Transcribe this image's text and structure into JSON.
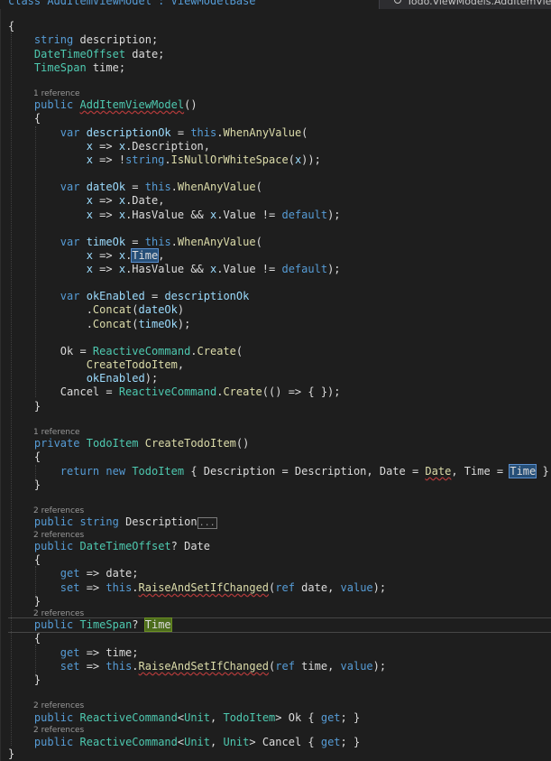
{
  "header": {
    "class_decl": "class AddItemViewModel : ViewModelBase",
    "nav_dropdown": "Todo.ViewModels.AddItemViewModel"
  },
  "codelens": {
    "ctor": "1 reference",
    "create_todo": "1 reference",
    "description_prop": "2 references",
    "date_prop": "2 references",
    "time_prop": "2 references",
    "ok_prop": "2 references",
    "cancel_prop": "2 references"
  },
  "colors": {
    "background": "#1e1e1e",
    "keyword": "#569cd6",
    "type": "#4ec9b0",
    "method": "#dcdcaa",
    "variable": "#9cdcfe",
    "text": "#dcdcdc"
  },
  "lines": [
    [
      [
        "t-plain",
        "{"
      ]
    ],
    [
      [
        "t-plain",
        "    "
      ],
      [
        "t-keyword",
        "string"
      ],
      [
        "t-plain",
        " description;"
      ]
    ],
    [
      [
        "t-plain",
        "    "
      ],
      [
        "t-type",
        "DateTimeOffset"
      ],
      [
        "t-plain",
        " date;"
      ]
    ],
    [
      [
        "t-plain",
        "    "
      ],
      [
        "t-type",
        "TimeSpan"
      ],
      [
        "t-plain",
        " time;"
      ]
    ],
    [
      [
        "t-plain",
        "    "
      ],
      [
        "t-keyword",
        "public"
      ],
      [
        "t-plain",
        " "
      ],
      [
        "t-squiggle-type",
        "AddItemViewModel"
      ],
      [
        "t-plain",
        "()"
      ]
    ],
    [
      [
        "t-plain",
        "    {"
      ]
    ],
    [
      [
        "t-plain",
        "        "
      ],
      [
        "t-keyword",
        "var"
      ],
      [
        "t-plain",
        " "
      ],
      [
        "t-var",
        "descriptionOk"
      ],
      [
        "t-plain",
        " = "
      ],
      [
        "t-keyword",
        "this"
      ],
      [
        "t-plain",
        "."
      ],
      [
        "t-method",
        "WhenAnyValue"
      ],
      [
        "t-plain",
        "("
      ]
    ],
    [
      [
        "t-plain",
        "            "
      ],
      [
        "t-var",
        "x"
      ],
      [
        "t-plain",
        " => "
      ],
      [
        "t-var",
        "x"
      ],
      [
        "t-plain",
        ".Description,"
      ]
    ],
    [
      [
        "t-plain",
        "            "
      ],
      [
        "t-var",
        "x"
      ],
      [
        "t-plain",
        " => !"
      ],
      [
        "t-keyword",
        "string"
      ],
      [
        "t-plain",
        "."
      ],
      [
        "t-method",
        "IsNullOrWhiteSpace"
      ],
      [
        "t-plain",
        "("
      ],
      [
        "t-var",
        "x"
      ],
      [
        "t-plain",
        "));"
      ]
    ],
    [
      [
        "t-plain",
        "        "
      ],
      [
        "t-keyword",
        "var"
      ],
      [
        "t-plain",
        " "
      ],
      [
        "t-var",
        "dateOk"
      ],
      [
        "t-plain",
        " = "
      ],
      [
        "t-keyword",
        "this"
      ],
      [
        "t-plain",
        "."
      ],
      [
        "t-method",
        "WhenAnyValue"
      ],
      [
        "t-plain",
        "("
      ]
    ],
    [
      [
        "t-plain",
        "            "
      ],
      [
        "t-var",
        "x"
      ],
      [
        "t-plain",
        " => "
      ],
      [
        "t-var",
        "x"
      ],
      [
        "t-plain",
        ".Date,"
      ]
    ],
    [
      [
        "t-plain",
        "            "
      ],
      [
        "t-var",
        "x"
      ],
      [
        "t-plain",
        " => "
      ],
      [
        "t-var",
        "x"
      ],
      [
        "t-plain",
        ".HasValue && "
      ],
      [
        "t-var",
        "x"
      ],
      [
        "t-plain",
        ".Value != "
      ],
      [
        "t-keyword",
        "default"
      ],
      [
        "t-plain",
        ");"
      ]
    ],
    [
      [
        "t-plain",
        "        "
      ],
      [
        "t-keyword",
        "var"
      ],
      [
        "t-plain",
        " "
      ],
      [
        "t-var",
        "timeOk"
      ],
      [
        "t-plain",
        " = "
      ],
      [
        "t-keyword",
        "this"
      ],
      [
        "t-plain",
        "."
      ],
      [
        "t-method",
        "WhenAnyValue"
      ],
      [
        "t-plain",
        "("
      ]
    ],
    [
      [
        "t-plain",
        "            "
      ],
      [
        "t-var",
        "x"
      ],
      [
        "t-plain",
        " => "
      ],
      [
        "t-var",
        "x"
      ],
      [
        "t-plain",
        "."
      ],
      [
        "t-hl",
        "Time"
      ],
      [
        "t-plain",
        ","
      ]
    ],
    [
      [
        "t-plain",
        "            "
      ],
      [
        "t-var",
        "x"
      ],
      [
        "t-plain",
        " => "
      ],
      [
        "t-var",
        "x"
      ],
      [
        "t-plain",
        ".HasValue && "
      ],
      [
        "t-var",
        "x"
      ],
      [
        "t-plain",
        ".Value != "
      ],
      [
        "t-keyword",
        "default"
      ],
      [
        "t-plain",
        ");"
      ]
    ],
    [
      [
        "t-plain",
        "        "
      ],
      [
        "t-keyword",
        "var"
      ],
      [
        "t-plain",
        " "
      ],
      [
        "t-var",
        "okEnabled"
      ],
      [
        "t-plain",
        " = "
      ],
      [
        "t-var",
        "descriptionOk"
      ]
    ],
    [
      [
        "t-plain",
        "            ."
      ],
      [
        "t-method",
        "Concat"
      ],
      [
        "t-plain",
        "("
      ],
      [
        "t-var",
        "dateOk"
      ],
      [
        "t-plain",
        ")"
      ]
    ],
    [
      [
        "t-plain",
        "            ."
      ],
      [
        "t-method",
        "Concat"
      ],
      [
        "t-plain",
        "("
      ],
      [
        "t-var",
        "timeOk"
      ],
      [
        "t-plain",
        ");"
      ]
    ],
    [
      [
        "t-plain",
        "        Ok = "
      ],
      [
        "t-type",
        "ReactiveCommand"
      ],
      [
        "t-plain",
        "."
      ],
      [
        "t-method",
        "Create"
      ],
      [
        "t-plain",
        "("
      ]
    ],
    [
      [
        "t-plain",
        "            "
      ],
      [
        "t-method",
        "CreateTodoItem"
      ],
      [
        "t-plain",
        ","
      ]
    ],
    [
      [
        "t-plain",
        "            "
      ],
      [
        "t-var",
        "okEnabled"
      ],
      [
        "t-plain",
        ");"
      ]
    ],
    [
      [
        "t-plain",
        "        Cancel = "
      ],
      [
        "t-type",
        "ReactiveCommand"
      ],
      [
        "t-plain",
        "."
      ],
      [
        "t-method",
        "Create"
      ],
      [
        "t-plain",
        "(() => { });"
      ]
    ],
    [
      [
        "t-plain",
        "    }"
      ]
    ],
    [
      [
        "t-plain",
        "    "
      ],
      [
        "t-keyword",
        "private"
      ],
      [
        "t-plain",
        " "
      ],
      [
        "t-type",
        "TodoItem"
      ],
      [
        "t-plain",
        " "
      ],
      [
        "t-method",
        "CreateTodoItem"
      ],
      [
        "t-plain",
        "()"
      ]
    ],
    [
      [
        "t-plain",
        "    {"
      ]
    ],
    [
      [
        "t-plain",
        "        "
      ],
      [
        "t-keyword",
        "return"
      ],
      [
        "t-plain",
        " "
      ],
      [
        "t-keyword",
        "new"
      ],
      [
        "t-plain",
        " "
      ],
      [
        "t-type",
        "TodoItem"
      ],
      [
        "t-plain",
        " { Description = Description, Date = "
      ],
      [
        "t-squiggle",
        "Date"
      ],
      [
        "t-plain",
        ", Time = "
      ],
      [
        "t-hl",
        "Time"
      ],
      [
        "t-plain",
        " };"
      ]
    ],
    [
      [
        "t-plain",
        "    }"
      ]
    ],
    [
      [
        "t-plain",
        "    "
      ],
      [
        "t-keyword",
        "public"
      ],
      [
        "t-plain",
        " "
      ],
      [
        "t-keyword",
        "string"
      ],
      [
        "t-plain",
        " Description"
      ],
      [
        "t-collapse",
        "..."
      ]
    ],
    [
      [
        "t-plain",
        "    "
      ],
      [
        "t-keyword",
        "public"
      ],
      [
        "t-plain",
        " "
      ],
      [
        "t-type",
        "DateTimeOffset"
      ],
      [
        "t-plain",
        "? Date"
      ]
    ],
    [
      [
        "t-plain",
        "    {"
      ]
    ],
    [
      [
        "t-plain",
        "        "
      ],
      [
        "t-keyword",
        "get"
      ],
      [
        "t-plain",
        " => date;"
      ]
    ],
    [
      [
        "t-plain",
        "        "
      ],
      [
        "t-keyword",
        "set"
      ],
      [
        "t-plain",
        " => "
      ],
      [
        "t-keyword",
        "this"
      ],
      [
        "t-plain",
        "."
      ],
      [
        "t-squiggle",
        "RaiseAndSetIfChanged"
      ],
      [
        "t-plain",
        "("
      ],
      [
        "t-keyword",
        "ref"
      ],
      [
        "t-plain",
        " date, "
      ],
      [
        "t-keyword",
        "value"
      ],
      [
        "t-plain",
        ");"
      ]
    ],
    [
      [
        "t-plain",
        "    }"
      ]
    ],
    [
      [
        "t-plain",
        "    "
      ],
      [
        "t-keyword",
        "public"
      ],
      [
        "t-plain",
        " "
      ],
      [
        "t-type",
        "TimeSpan"
      ],
      [
        "t-plain",
        "? "
      ],
      [
        "t-def",
        "Time"
      ]
    ],
    [
      [
        "t-plain",
        "    {"
      ]
    ],
    [
      [
        "t-plain",
        "        "
      ],
      [
        "t-keyword",
        "get"
      ],
      [
        "t-plain",
        " => time;"
      ]
    ],
    [
      [
        "t-plain",
        "        "
      ],
      [
        "t-keyword",
        "set"
      ],
      [
        "t-plain",
        " => "
      ],
      [
        "t-keyword",
        "this"
      ],
      [
        "t-plain",
        "."
      ],
      [
        "t-squiggle",
        "RaiseAndSetIfChanged"
      ],
      [
        "t-plain",
        "("
      ],
      [
        "t-keyword",
        "ref"
      ],
      [
        "t-plain",
        " time, "
      ],
      [
        "t-keyword",
        "value"
      ],
      [
        "t-plain",
        ");"
      ]
    ],
    [
      [
        "t-plain",
        "    }"
      ]
    ],
    [
      [
        "t-plain",
        "    "
      ],
      [
        "t-keyword",
        "public"
      ],
      [
        "t-plain",
        " "
      ],
      [
        "t-type",
        "ReactiveCommand"
      ],
      [
        "t-plain",
        "<"
      ],
      [
        "t-type",
        "Unit"
      ],
      [
        "t-plain",
        ", "
      ],
      [
        "t-type",
        "TodoItem"
      ],
      [
        "t-plain",
        "> Ok { "
      ],
      [
        "t-keyword",
        "get"
      ],
      [
        "t-plain",
        "; }"
      ]
    ],
    [
      [
        "t-plain",
        "    "
      ],
      [
        "t-keyword",
        "public"
      ],
      [
        "t-plain",
        " "
      ],
      [
        "t-type",
        "ReactiveCommand"
      ],
      [
        "t-plain",
        "<"
      ],
      [
        "t-type",
        "Unit"
      ],
      [
        "t-plain",
        ", "
      ],
      [
        "t-type",
        "Unit"
      ],
      [
        "t-plain",
        "> Cancel { "
      ],
      [
        "t-keyword",
        "get"
      ],
      [
        "t-plain",
        "; }"
      ]
    ],
    [
      [
        "t-plain",
        "}"
      ]
    ]
  ]
}
